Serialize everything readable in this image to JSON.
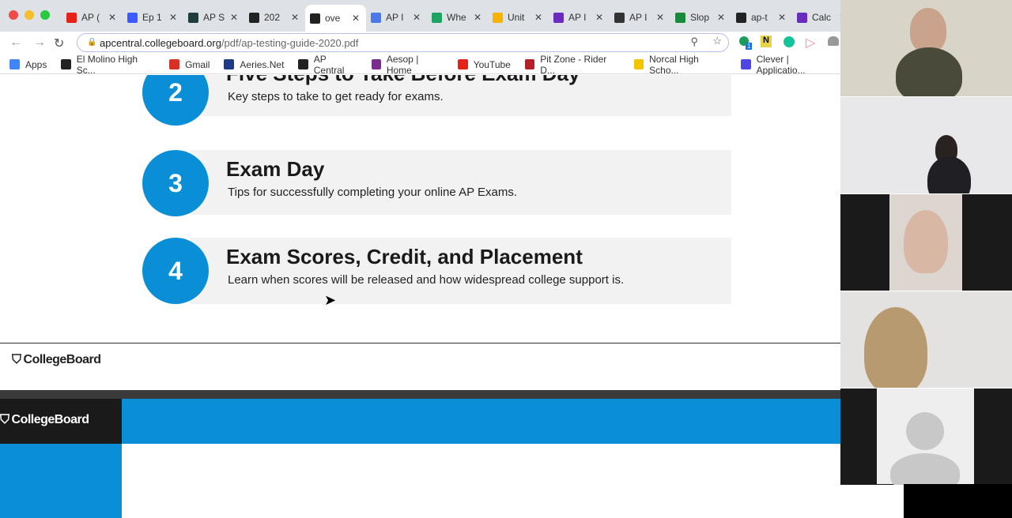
{
  "browser": {
    "tabs": [
      {
        "label": "AP (",
        "icon": "youtube-icon",
        "color": "#e62117"
      },
      {
        "label": "Ep 1",
        "icon": "dropbox-icon",
        "color": "#3d5afe"
      },
      {
        "label": "AP S",
        "icon": "atom-icon",
        "color": "#1f3d3d"
      },
      {
        "label": "202",
        "icon": "collegeboard-icon",
        "color": "#222"
      },
      {
        "label": "ove",
        "icon": "collegeboard-icon",
        "color": "#222",
        "active": true
      },
      {
        "label": "AP I",
        "icon": "docs-icon",
        "color": "#4a78e8"
      },
      {
        "label": "Whe",
        "icon": "sheets-icon",
        "color": "#1ea362"
      },
      {
        "label": "Unit",
        "icon": "drive-icon",
        "color": "#f4b400"
      },
      {
        "label": "AP I",
        "icon": "forms-icon",
        "color": "#6a2cbf"
      },
      {
        "label": "AP I",
        "icon": "classroom-icon",
        "color": "#333"
      },
      {
        "label": "Slop",
        "icon": "geogebra-icon",
        "color": "#1a8a3a"
      },
      {
        "label": "ap-t",
        "icon": "collegeboard-icon",
        "color": "#222"
      },
      {
        "label": "Calc",
        "icon": "forms-icon",
        "color": "#6a2cbf"
      }
    ],
    "url_host": "apcentral.collegeboard.org",
    "url_path": "/pdf/ap-testing-guide-2020.pdf",
    "bookmarks": [
      {
        "label": "Apps",
        "color": "#4285f4"
      },
      {
        "label": "El Molino High Sc...",
        "color": "#222"
      },
      {
        "label": "Gmail",
        "color": "#d93025"
      },
      {
        "label": "Aeries.Net",
        "color": "#1e3a8a"
      },
      {
        "label": "AP Central",
        "color": "#222"
      },
      {
        "label": "Aesop | Home",
        "color": "#7b2d8e"
      },
      {
        "label": "YouTube",
        "color": "#e62117"
      },
      {
        "label": "Pit Zone - Rider D...",
        "color": "#b3202a"
      },
      {
        "label": "Norcal High Scho...",
        "color": "#f2c500"
      },
      {
        "label": "Clever | Applicatio...",
        "color": "#4f46e5"
      }
    ],
    "extension_badge": "1"
  },
  "steps": [
    {
      "number": "2",
      "title": "Five Steps to Take Before Exam Day",
      "desc": "Key steps to take to get ready for exams."
    },
    {
      "number": "3",
      "title": "Exam Day",
      "desc": "Tips for successfully completing your online AP Exams."
    },
    {
      "number": "4",
      "title": "Exam Scores, Credit, and Placement",
      "desc": "Learn when scores will be released and how widespread college support is."
    }
  ],
  "footer": {
    "logo": "CollegeBoard"
  },
  "banner": {
    "logo": "CollegeBoard"
  },
  "colors": {
    "accent": "#0a8fd6"
  }
}
